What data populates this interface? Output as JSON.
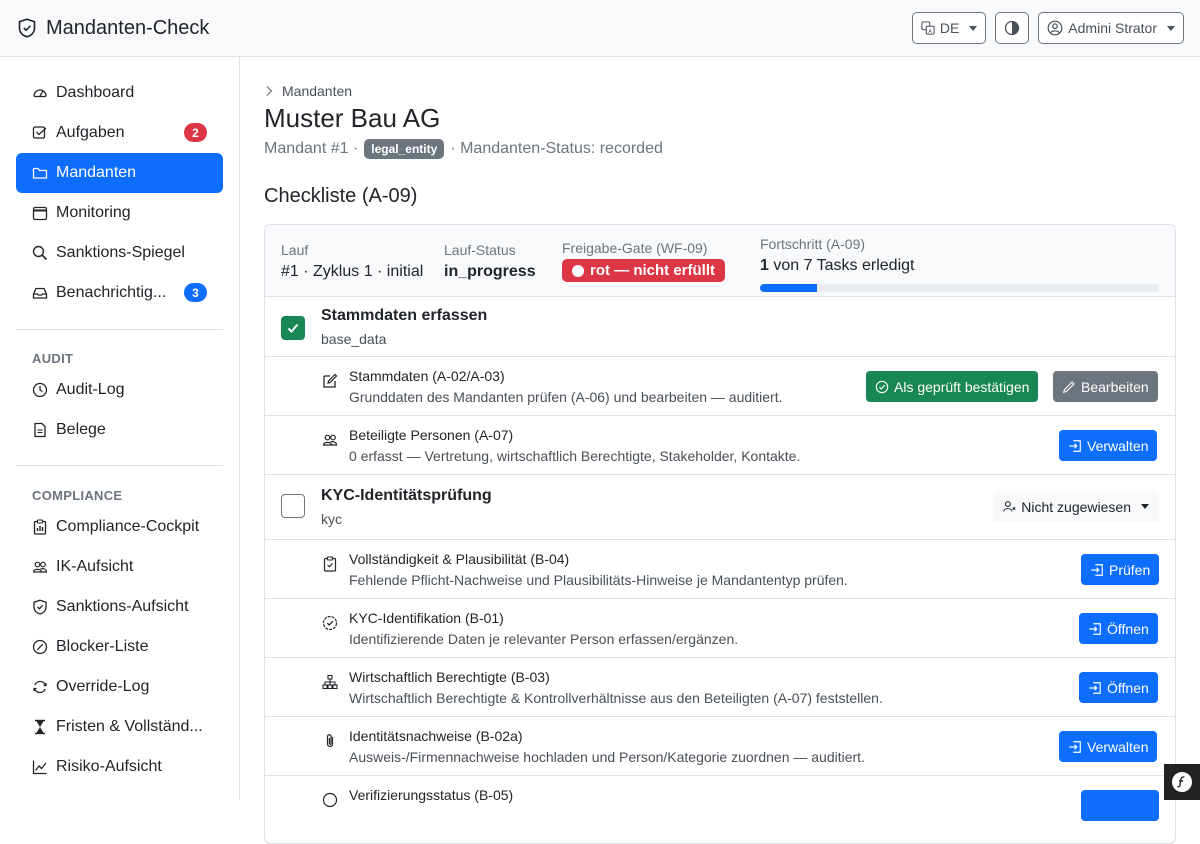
{
  "app": {
    "title": "Mandanten-Check"
  },
  "topbar": {
    "lang": "DE",
    "user": "Admini Strator"
  },
  "sidebar": {
    "items": [
      {
        "label": "Dashboard",
        "icon": "speedometer-icon"
      },
      {
        "label": "Aufgaben",
        "icon": "checkbox-icon",
        "badge": "2",
        "badge_color": "#dc3545"
      },
      {
        "label": "Mandanten",
        "icon": "folder-icon",
        "active": true
      },
      {
        "label": "Monitoring",
        "icon": "calendar-icon"
      },
      {
        "label": "Sanktions-Spiegel",
        "icon": "search-icon"
      },
      {
        "label": "Benachrichtig...",
        "icon": "inbox-icon",
        "badge": "3",
        "badge_color": "#0d6efd"
      }
    ],
    "audit_title": "AUDIT",
    "audit_items": [
      {
        "label": "Audit-Log",
        "icon": "clock-icon"
      },
      {
        "label": "Belege",
        "icon": "document-icon"
      }
    ],
    "compliance_title": "COMPLIANCE",
    "compliance_items": [
      {
        "label": "Compliance-Cockpit",
        "icon": "clipboard-data-icon"
      },
      {
        "label": "IK-Aufsicht",
        "icon": "people-icon"
      },
      {
        "label": "Sanktions-Aufsicht",
        "icon": "shield-icon"
      },
      {
        "label": "Blocker-Liste",
        "icon": "slash-circle-icon"
      },
      {
        "label": "Override-Log",
        "icon": "arrow-repeat-icon"
      },
      {
        "label": "Fristen & Vollständ...",
        "icon": "hourglass-icon"
      },
      {
        "label": "Risiko-Aufsicht",
        "icon": "graph-icon"
      }
    ]
  },
  "page": {
    "breadcrumb": "Mandanten",
    "title": "Muster Bau AG",
    "subtitle_prefix": "Mandant #1 ·",
    "entity_type": "legal_entity",
    "subtitle_suffix": "· Mandanten-Status: recorded",
    "section_title": "Checkliste (A-09)"
  },
  "run": {
    "lauf_label": "Lauf",
    "lauf_value": "#1 · Zyklus 1 · initial",
    "status_label": "Lauf-Status",
    "status_value": "in_progress",
    "gate_label": "Freigabe-Gate (WF-09)",
    "gate_value": "rot — nicht erfüllt",
    "gate_color": "#dc3545",
    "progress_label": "Fortschritt (A-09)",
    "progress_done": "1",
    "progress_text": "von 7 Tasks erledigt",
    "progress_fraction": 0.143
  },
  "groups": [
    {
      "title": "Stammdaten erfassen",
      "key": "base_data",
      "checked": true,
      "tasks": [
        {
          "title": "Stammdaten (A-02/A-03)",
          "desc": "Grunddaten des Mandanten prüfen (A-06) und bearbeiten — auditiert.",
          "icon": "pencil-square-icon",
          "buttons": [
            "Als geprüft bestätigen",
            "Bearbeiten"
          ]
        },
        {
          "title": "Beteiligte Personen (A-07)",
          "desc": "0 erfasst — Vertretung, wirtschaftlich Berechtigte, Stakeholder, Kontakte.",
          "icon": "people-icon",
          "buttons": [
            "Verwalten"
          ]
        }
      ]
    },
    {
      "title": "KYC-Identitätsprüfung",
      "key": "kyc",
      "checked": false,
      "assignee": "Nicht zugewiesen",
      "tasks": [
        {
          "title": "Vollständigkeit & Plausibilität (B-04)",
          "desc": "Fehlende Pflicht-Nachweise und Plausibilitäts-Hinweise je Mandantentyp prüfen.",
          "icon": "clipboard-check-icon",
          "buttons": [
            "Prüfen"
          ]
        },
        {
          "title": "KYC-Identifikation (B-01)",
          "desc": "Identifizierende Daten je relevanter Person erfassen/ergänzen.",
          "icon": "patch-check-icon",
          "buttons": [
            "Öffnen"
          ]
        },
        {
          "title": "Wirtschaftlich Berechtigte (B-03)",
          "desc": "Wirtschaftlich Berechtigte & Kontrollverhältnisse aus den Beteiligten (A-07) feststellen.",
          "icon": "diagram-icon",
          "buttons": [
            "Öffnen"
          ]
        },
        {
          "title": "Identitätsnachweise (B-02a)",
          "desc": "Ausweis-/Firmennachweise hochladen und Person/Kategorie zuordnen — auditiert.",
          "icon": "paperclip-icon",
          "buttons": [
            "Verwalten"
          ]
        },
        {
          "title": "Verifizierungsstatus (B-05)",
          "desc": "",
          "icon": "shield-check-icon",
          "buttons": [
            ""
          ]
        }
      ]
    }
  ]
}
